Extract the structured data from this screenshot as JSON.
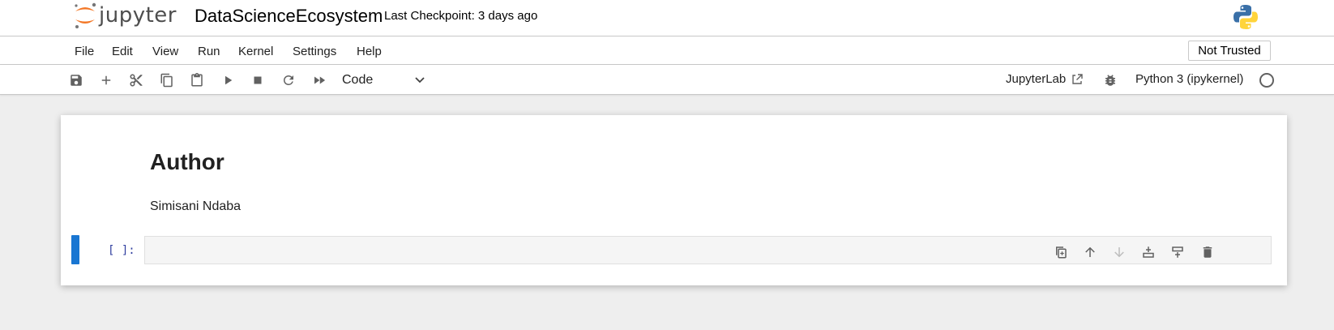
{
  "header": {
    "logo_text": "jupyter",
    "notebook_title": "DataScienceEcosystem",
    "checkpoint": "Last Checkpoint: 3 days ago",
    "kernel_logo_icon": "python-logo-icon"
  },
  "menu": {
    "items": [
      "File",
      "Edit",
      "View",
      "Run",
      "Kernel",
      "Settings",
      "Help"
    ],
    "trust_status": "Not Trusted"
  },
  "toolbar": {
    "icons": [
      "save-icon",
      "add-icon",
      "cut-icon",
      "copy-icon",
      "paste-icon",
      "run-icon",
      "stop-icon",
      "restart-icon",
      "fast-forward-icon"
    ],
    "cell_type": "Code",
    "jupyterlab_label": "JupyterLab",
    "kernel_name": "Python 3 (ipykernel)"
  },
  "notebook": {
    "cells": [
      {
        "type": "markdown",
        "heading": "Author",
        "text": "Simisani Ndaba"
      },
      {
        "type": "code",
        "prompt": "[ ]:",
        "source": "",
        "tools": [
          "duplicate-icon",
          "move-up-icon",
          "move-down-icon",
          "insert-above-icon",
          "insert-below-icon",
          "delete-icon"
        ]
      }
    ]
  },
  "colors": {
    "accent": "#1976d2",
    "prompt": "#303f9f",
    "background": "#eeeeee",
    "logo_orange": "#f37726",
    "python_blue": "#3a70a8",
    "python_yellow": "#ffd43b"
  }
}
